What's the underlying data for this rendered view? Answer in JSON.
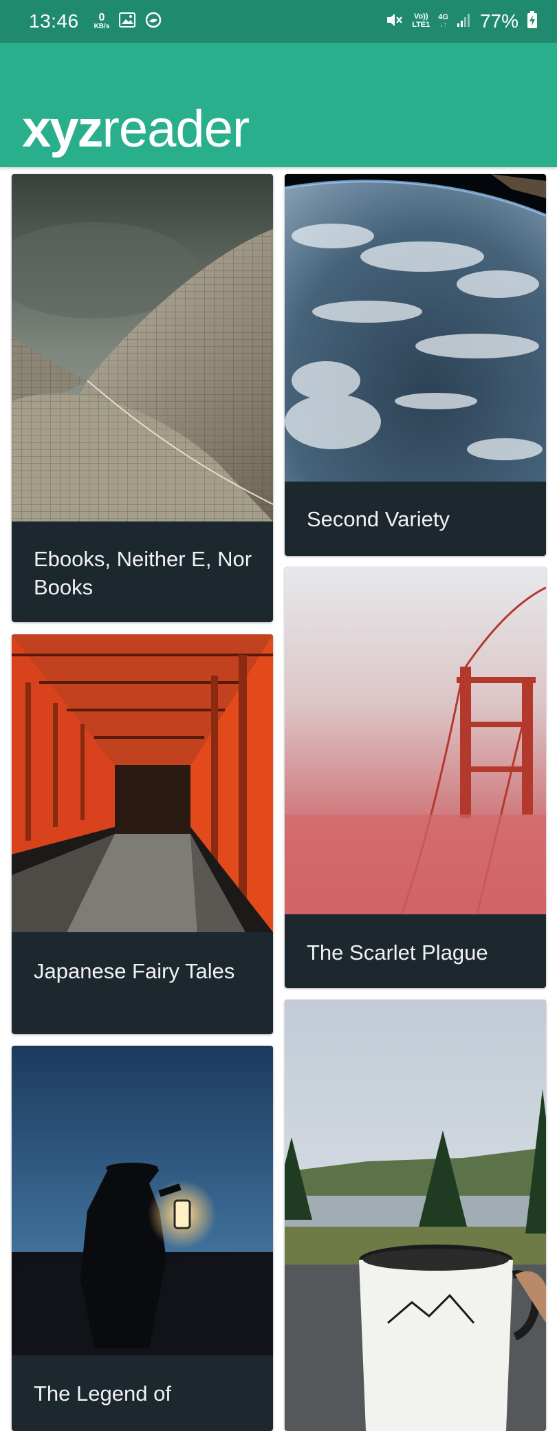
{
  "status_bar": {
    "time": "13:46",
    "data_rate_value": "0",
    "data_rate_unit": "KB/s",
    "volte_label": "Vo))",
    "lte_label": "LTE1",
    "network_label": "4G",
    "battery_percent": "77%"
  },
  "app": {
    "logo_bold": "xyz",
    "logo_light": "reader"
  },
  "articles": [
    {
      "title": "Ebooks, Neither E, Nor Books",
      "image": "architecture-shells"
    },
    {
      "title": "Second Variety",
      "image": "earth-from-space"
    },
    {
      "title": "Japanese Fairy Tales",
      "image": "torii-gates-path"
    },
    {
      "title": "The Scarlet Plague",
      "image": "bridge-in-fog"
    },
    {
      "title": "The Legend of",
      "image": "lantern-at-dusk"
    },
    {
      "title": "",
      "image": "adventure-mug-lake"
    }
  ],
  "colors": {
    "status_bar": "#1f8a6e",
    "app_bar": "#29af8c",
    "card_background": "#1c272e"
  }
}
